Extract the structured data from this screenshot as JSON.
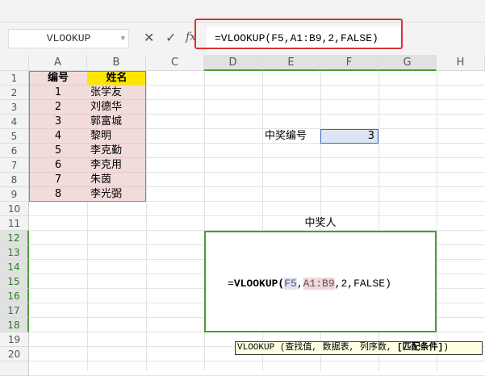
{
  "name_box": "VLOOKUP",
  "formula_bar": {
    "fx": "fx",
    "cancel": "✕",
    "confirm": "✓",
    "formula": "=VLOOKUP(F5,A1:B9,2,FALSE)"
  },
  "columns": [
    "A",
    "B",
    "C",
    "D",
    "E",
    "F",
    "G",
    "H"
  ],
  "rows": [
    "1",
    "2",
    "3",
    "4",
    "5",
    "6",
    "7",
    "8",
    "9",
    "10",
    "11",
    "12",
    "13",
    "14",
    "15",
    "16",
    "17",
    "18",
    "19",
    "20"
  ],
  "table": {
    "header_id": "编号",
    "header_name": "姓名",
    "ids": [
      "1",
      "2",
      "3",
      "4",
      "5",
      "6",
      "7",
      "8"
    ],
    "names": [
      "张学友",
      "刘德华",
      "郭富城",
      "黎明",
      "李克勤",
      "李克用",
      "朱茵",
      "李光弼"
    ]
  },
  "lookup": {
    "label": "中奖编号",
    "value": "3"
  },
  "result": {
    "title": "中奖人",
    "f_eq": "=",
    "f_fn": "VLOOKUP",
    "f_open": "(",
    "f_ref1": "F5",
    "f_sep1": ",",
    "f_ref2": "A1:B9",
    "f_rest": ",2,FALSE)"
  },
  "tooltip": {
    "fn": "VLOOKUP",
    "args": " (查找值, 数据表, 列序数, ",
    "opt": "[匹配条件]",
    "close": ")"
  }
}
